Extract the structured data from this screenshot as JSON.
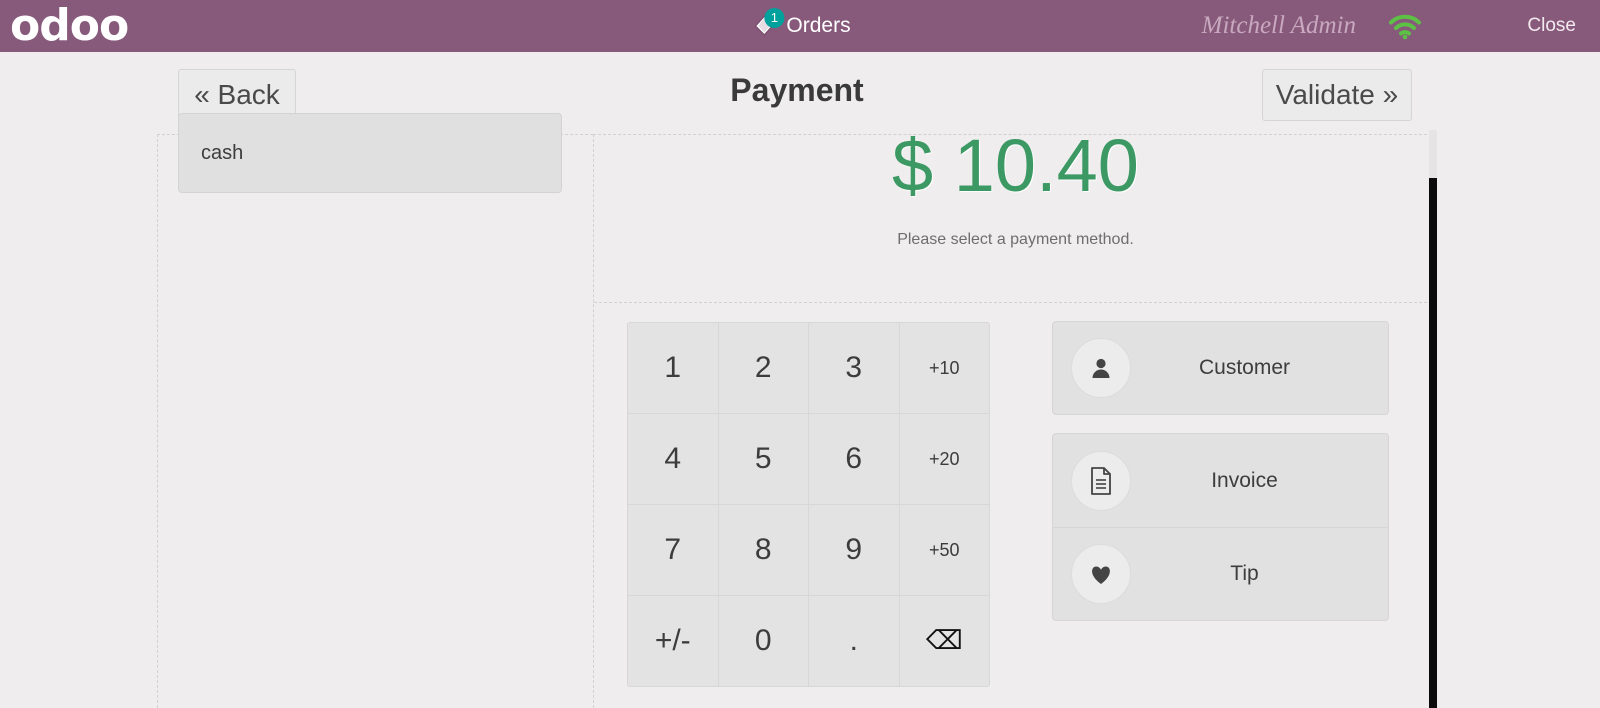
{
  "topbar": {
    "logo": "odoo",
    "orders_label": "Orders",
    "orders_badge": "1",
    "orders_icon": "orders-diamond-icon",
    "user_name": "Mitchell Admin",
    "wifi_icon": "wifi-icon",
    "wifi_color": "#5cc144",
    "close_label": "Close",
    "background": "#875a7b"
  },
  "navbar": {
    "back_label": "« Back",
    "title": "Payment",
    "validate_label": "Validate »"
  },
  "payment_methods": [
    {
      "label": "cash"
    }
  ],
  "amount": {
    "value": "$ 10.40",
    "color": "#3d9964",
    "hint": "Please select a payment method."
  },
  "numpad": {
    "keys": [
      {
        "label": "1",
        "name": "numpad-key-1",
        "size": "large"
      },
      {
        "label": "2",
        "name": "numpad-key-2",
        "size": "large"
      },
      {
        "label": "3",
        "name": "numpad-key-3",
        "size": "large"
      },
      {
        "label": "+10",
        "name": "numpad-key-plus-10",
        "size": "small"
      },
      {
        "label": "4",
        "name": "numpad-key-4",
        "size": "large"
      },
      {
        "label": "5",
        "name": "numpad-key-5",
        "size": "large"
      },
      {
        "label": "6",
        "name": "numpad-key-6",
        "size": "large"
      },
      {
        "label": "+20",
        "name": "numpad-key-plus-20",
        "size": "small"
      },
      {
        "label": "7",
        "name": "numpad-key-7",
        "size": "large"
      },
      {
        "label": "8",
        "name": "numpad-key-8",
        "size": "large"
      },
      {
        "label": "9",
        "name": "numpad-key-9",
        "size": "large"
      },
      {
        "label": "+50",
        "name": "numpad-key-plus-50",
        "size": "small"
      },
      {
        "label": "+/-",
        "name": "numpad-key-sign",
        "size": "large"
      },
      {
        "label": "0",
        "name": "numpad-key-0",
        "size": "large"
      },
      {
        "label": ".",
        "name": "numpad-key-decimal",
        "size": "large"
      },
      {
        "label": "⌫",
        "name": "numpad-key-backspace",
        "size": "icon"
      }
    ]
  },
  "actions": {
    "customer": {
      "label": "Customer",
      "icon": "person-icon"
    },
    "invoice": {
      "label": "Invoice",
      "icon": "document-icon"
    },
    "tip": {
      "label": "Tip",
      "icon": "heart-icon"
    }
  },
  "scrollbar": {
    "thumb_color": "#0b0b0b",
    "track_color": "#e6e4e5"
  }
}
